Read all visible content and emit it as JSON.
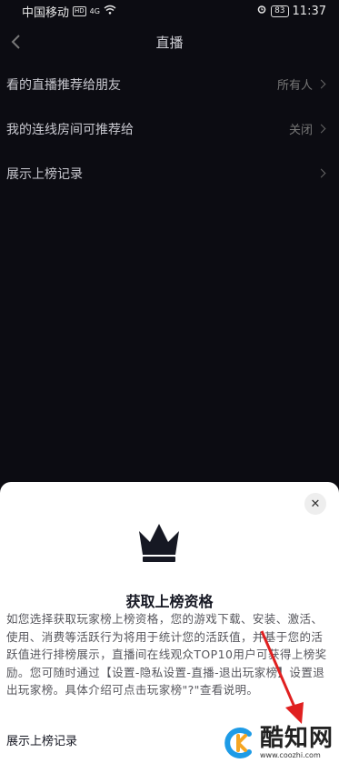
{
  "status_bar": {
    "carrier": "中国移动",
    "hd_badge": "HD",
    "signal": "4G",
    "battery": "83",
    "time": "11:37"
  },
  "nav": {
    "title": "直播",
    "back_icon": "chevron-left-icon"
  },
  "settings": [
    {
      "label": "看的直播推荐给朋友",
      "value": "所有人"
    },
    {
      "label": "我的连线房间可推荐给",
      "value": "关闭"
    },
    {
      "label": "展示上榜记录",
      "value": ""
    }
  ],
  "sheet": {
    "title": "获取上榜资格",
    "body": "如您选择获取玩家榜上榜资格，您的游戏下载、安装、激活、使用、消费等活跃行为将用于统计您的活跃值，并基于您的活跃值进行排榜展示，直播间在线观众TOP10用户可获得上榜奖励。您可随时通过【设置-隐私设置-直播-退出玩家榜】设置退出玩家榜。具体介绍可点击玩家榜\"?\"查看说明。",
    "row_label": "展示上榜记录",
    "crown_icon": "crown-icon",
    "close_icon": "close-icon"
  },
  "watermark": {
    "text": "酷知网",
    "url": "www.coozhi.com"
  },
  "colors": {
    "background": "#0c0c12",
    "sheet": "#ffffff",
    "crown": "#161823",
    "arrow": "#e02020",
    "logo_blue": "#1e9be6",
    "logo_orange": "#f5a623"
  }
}
